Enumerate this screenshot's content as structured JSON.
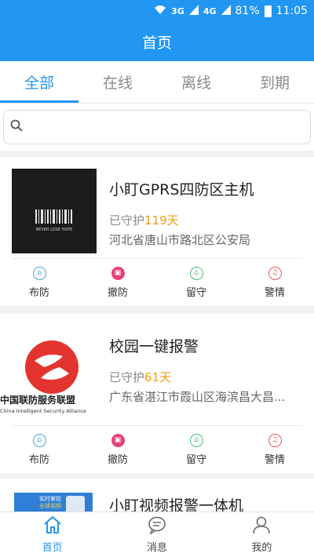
{
  "status_bar": {
    "network": "3G",
    "network2": "4G",
    "battery": "81%",
    "time": "11:05"
  },
  "header": {
    "title": "首页"
  },
  "tabs": [
    {
      "label": "全部",
      "active": true
    },
    {
      "label": "在线",
      "active": false
    },
    {
      "label": "离线",
      "active": false
    },
    {
      "label": "到期",
      "active": false
    }
  ],
  "search": {
    "placeholder": ""
  },
  "devices": [
    {
      "name": "小盯GPRS四防区主机",
      "guard_prefix": "已守护",
      "guard_days": "119天",
      "address": "河北省唐山市路北区公安局",
      "thumb_text": "NEVER LOSE HOPE"
    },
    {
      "name": "校园一键报警",
      "guard_prefix": "已守护",
      "guard_days": "61天",
      "address": "广东省湛江市霞山区海滨昌大昌...",
      "logo_cn": "中国联防服务联盟",
      "logo_en": "China Intelligent Security Alliance"
    },
    {
      "name": "小盯视频报警一体机",
      "thumb_text1": "实时掌控",
      "thumb_text2": "全球视频"
    }
  ],
  "actions": [
    {
      "label": "布防",
      "icon": "lock-open-icon"
    },
    {
      "label": "撤防",
      "icon": "lock-icon"
    },
    {
      "label": "留守",
      "icon": "home-icon"
    },
    {
      "label": "警情",
      "icon": "alarm-bell-icon"
    }
  ],
  "bottom_nav": [
    {
      "label": "首页",
      "icon": "home-icon",
      "active": true
    },
    {
      "label": "消息",
      "icon": "message-icon",
      "active": false
    },
    {
      "label": "我的",
      "icon": "user-icon",
      "active": false
    }
  ],
  "colors": {
    "primary": "#2196f3",
    "days": "#f39c12",
    "pink": "#e8407a",
    "green": "#4cbf6a",
    "red": "#e85757"
  }
}
